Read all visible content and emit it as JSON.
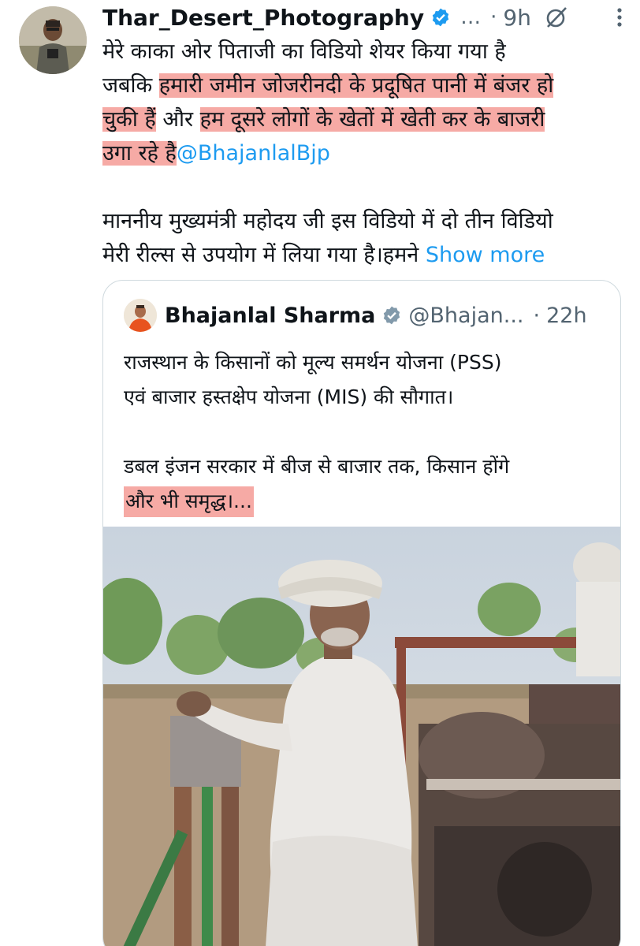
{
  "tweet": {
    "author": {
      "name": "Thar_Desert_Photography",
      "handle_truncated": "…"
    },
    "separator": "·",
    "time": "9h",
    "text_lines": [
      {
        "segments": [
          {
            "text": "मेरे काका ओर पिताजी का विडियो शेयर किया गया है",
            "style": "plain"
          }
        ]
      },
      {
        "segments": [
          {
            "text": "जबकि ",
            "style": "plain"
          },
          {
            "text": "हमारी जमीन जोजरीनदी के प्रदूषित पानी में बंजर हो",
            "style": "highlight"
          }
        ]
      },
      {
        "segments": [
          {
            "text": "चुकी हैं",
            "style": "highlight"
          },
          {
            "text": " और ",
            "style": "plain"
          },
          {
            "text": "हम दूसरे लोगों के खेतों में खेती कर के बाजरी",
            "style": "highlight"
          }
        ]
      },
      {
        "segments": [
          {
            "text": "उगा रहे है",
            "style": "highlight"
          },
          {
            "text": "@BhajanlalBjp",
            "style": "mention"
          }
        ]
      },
      {
        "segments": []
      },
      {
        "segments": [
          {
            "text": "माननीय मुख्यमंत्री महोदय जी इस विडियो में दो तीन विडियो",
            "style": "plain"
          }
        ]
      },
      {
        "segments": [
          {
            "text": "मेरी रील्स से उपयोग में लिया गया है।हमने ",
            "style": "plain"
          },
          {
            "text": "Show more",
            "style": "link"
          }
        ]
      }
    ]
  },
  "quoted": {
    "author": {
      "name": "Bhajanlal Sharma",
      "handle": "@Bhajan..."
    },
    "separator": "·",
    "time": "22h",
    "text_lines": [
      {
        "segments": [
          {
            "text": "राजस्थान के किसानों को मूल्य समर्थन योजना (PSS)",
            "style": "plain"
          }
        ]
      },
      {
        "segments": [
          {
            "text": "एवं बाजार हस्तक्षेप योजना (MIS) की सौगात।",
            "style": "plain"
          }
        ]
      },
      {
        "segments": []
      },
      {
        "segments": [
          {
            "text": "डबल इंजन सरकार में बीज से बाजार तक, किसान होंगे",
            "style": "plain"
          }
        ]
      },
      {
        "segments": [
          {
            "text": "और भी समृद्ध।...",
            "style": "highlight"
          }
        ]
      }
    ]
  },
  "colors": {
    "text": "#0f1419",
    "secondary": "#536471",
    "link": "#1d9bf0",
    "highlight": "#f6aaa5",
    "border": "#cfd9de"
  },
  "icons": {
    "verified": "verified-badge-icon",
    "grok": "grok-icon",
    "more": "more-options-icon"
  }
}
